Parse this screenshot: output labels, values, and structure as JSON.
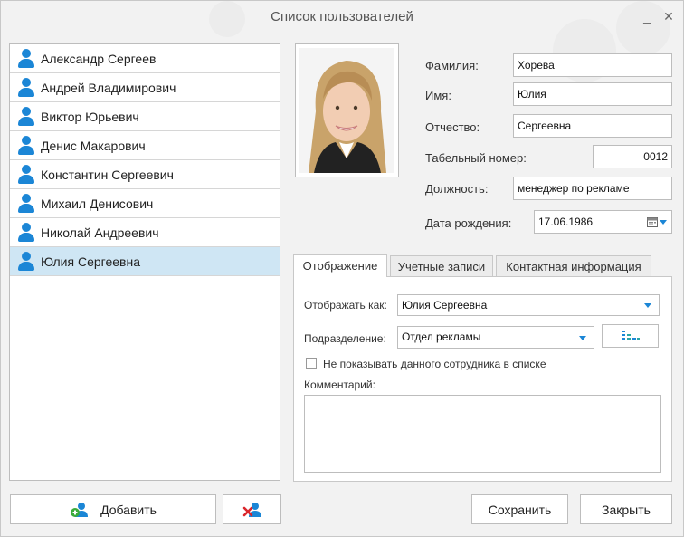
{
  "window": {
    "title": "Список пользователей",
    "minimize_glyph": "_",
    "close_glyph": "✕"
  },
  "users": [
    "Александр Сергеев",
    "Андрей Владимирович",
    "Виктор Юрьевич",
    "Денис Макарович",
    "Константин Сергеевич",
    "Михаил Денисович",
    "Николай Андреевич",
    "Юлия Сергеевна"
  ],
  "selected_index": 7,
  "buttons": {
    "add": "Добавить",
    "save": "Сохранить",
    "close": "Закрыть"
  },
  "form": {
    "lastname_label": "Фамилия:",
    "lastname": "Хорева",
    "firstname_label": "Имя:",
    "firstname": "Юлия",
    "patronymic_label": "Отчество:",
    "patronymic": "Сергеевна",
    "tabnum_label": "Табельный номер:",
    "tabnum": "0012",
    "position_label": "Должность:",
    "position": "менеджер по рекламе",
    "birth_label": "Дата рождения:",
    "birth": "17.06.1986"
  },
  "tabs": [
    "Отображение",
    "Учетные записи",
    "Контактная информация"
  ],
  "display": {
    "show_as_label": "Отображать как:",
    "show_as": "Юлия Сергеевна",
    "dept_label": "Подразделение:",
    "dept": "Отдел рекламы",
    "hide_label": "Не показывать данного сотрудника в списке",
    "comment_label": "Комментарий:",
    "comment": ""
  },
  "colors": {
    "accent": "#1b86d6",
    "selected_row": "#cfe6f4",
    "add_plus": "#3bab3b",
    "delete_x": "#d9262c"
  },
  "icons": {
    "user": "user-icon",
    "add_user": "add-user-icon",
    "delete_user": "delete-user-icon",
    "calendar": "calendar-icon",
    "dropdown": "chevron-down-icon",
    "org_chart": "org-chart-icon"
  }
}
